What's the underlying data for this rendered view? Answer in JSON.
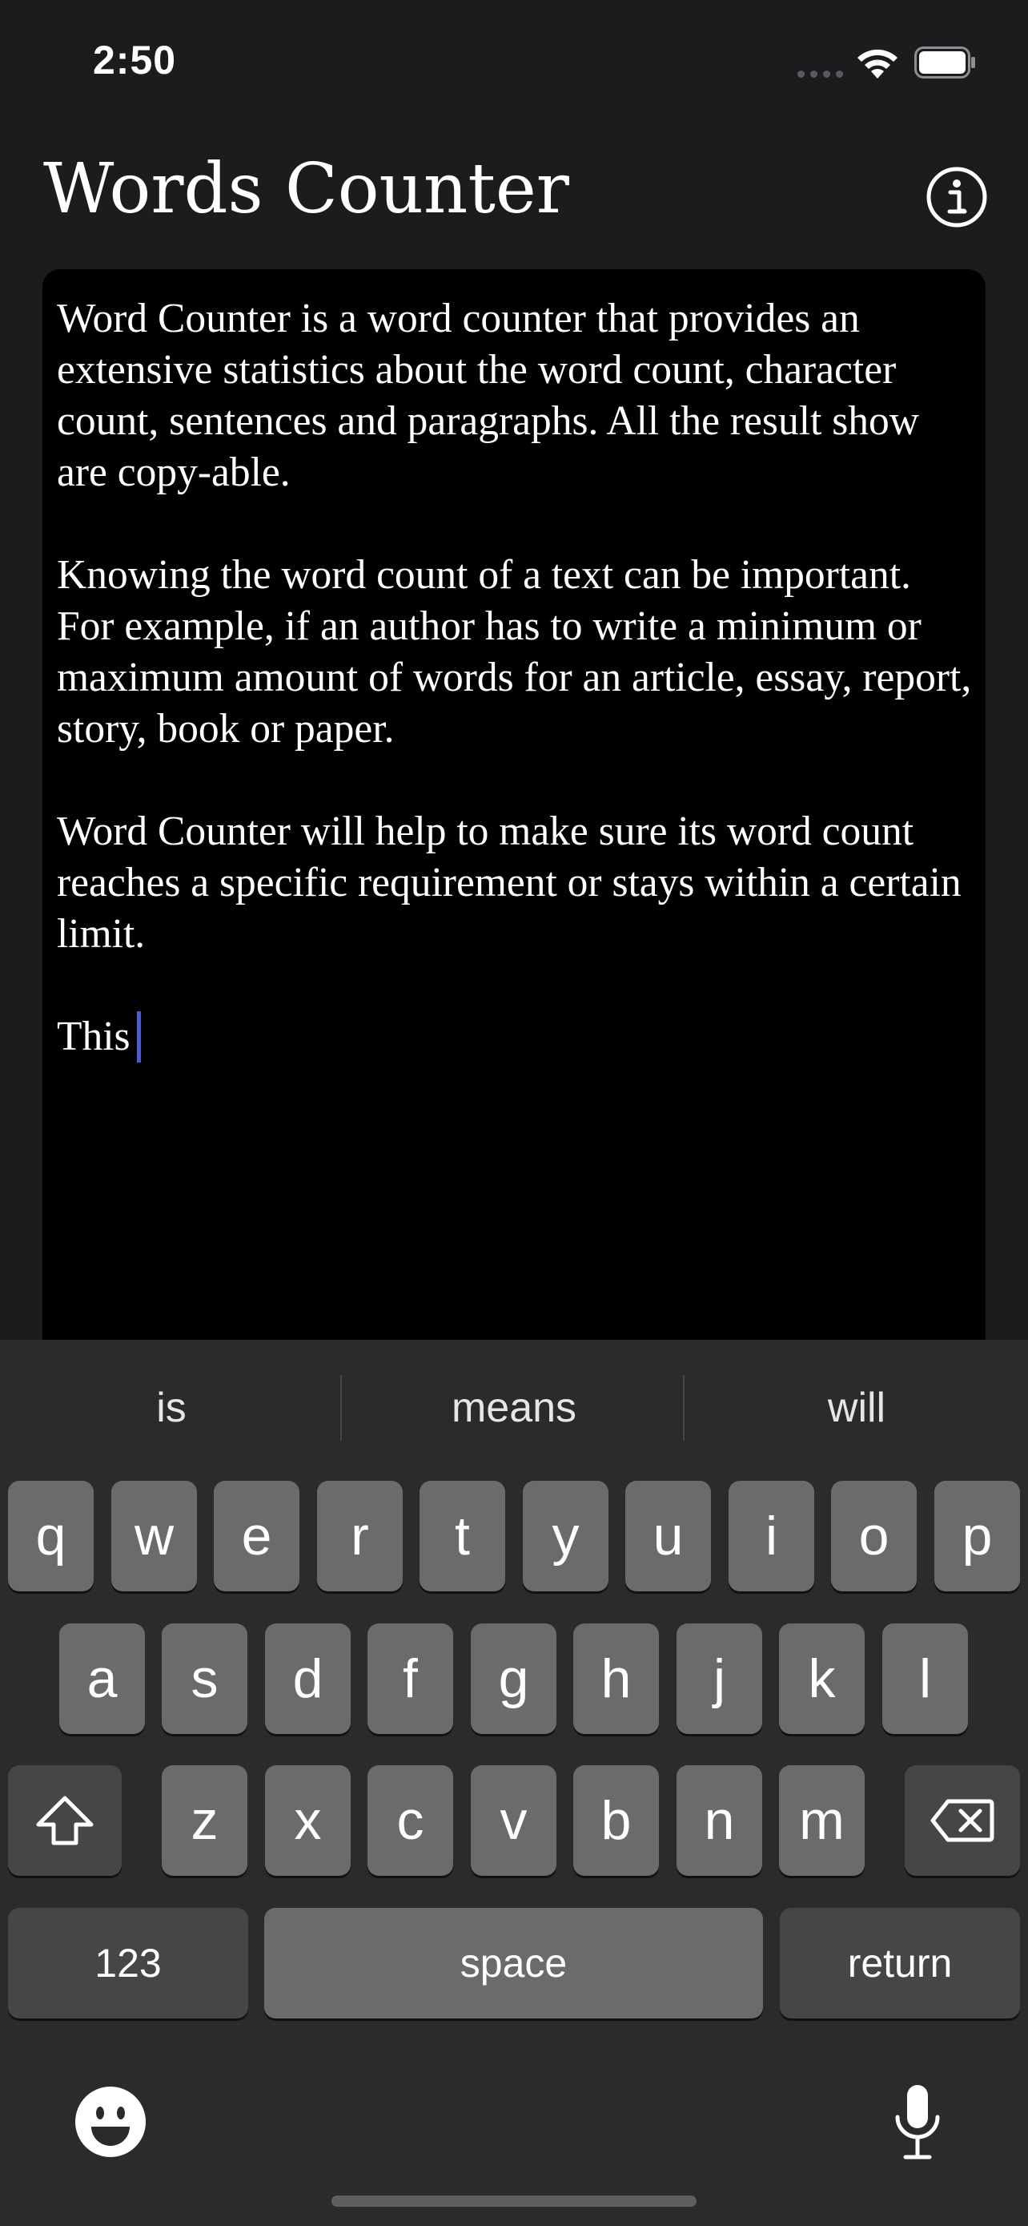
{
  "status_bar": {
    "time": "2:50"
  },
  "header": {
    "title": "Words Counter"
  },
  "editor": {
    "paragraphs": [
      "Word Counter is a word counter that provides an extensive statistics about the word count, character count, sentences and paragraphs. All the result show are copy-able.",
      "Knowing the word count of a text can be important. For example, if an author has to write a minimum or maximum amount of words for an article, essay, report, story, book or paper.",
      "Word Counter will help to make sure its word count reaches a specific requirement or stays within a certain limit."
    ],
    "current_line": "This"
  },
  "keyboard": {
    "suggestions": [
      "is",
      "means",
      "will"
    ],
    "row1": [
      "q",
      "w",
      "e",
      "r",
      "t",
      "y",
      "u",
      "i",
      "o",
      "p"
    ],
    "row2": [
      "a",
      "s",
      "d",
      "f",
      "g",
      "h",
      "j",
      "k",
      "l"
    ],
    "row3": [
      "z",
      "x",
      "c",
      "v",
      "b",
      "n",
      "m"
    ],
    "numbers_label": "123",
    "space_label": "space",
    "return_label": "return"
  },
  "icons": {
    "info": "info-icon",
    "shift": "shift-icon",
    "delete": "delete-icon",
    "emoji": "emoji-icon",
    "microphone": "microphone-icon"
  },
  "colors": {
    "background": "#1c1c1e",
    "editor_background": "#000000",
    "caret": "#4a5bd4",
    "key": "#6b6b6e",
    "function_key": "#464649"
  }
}
